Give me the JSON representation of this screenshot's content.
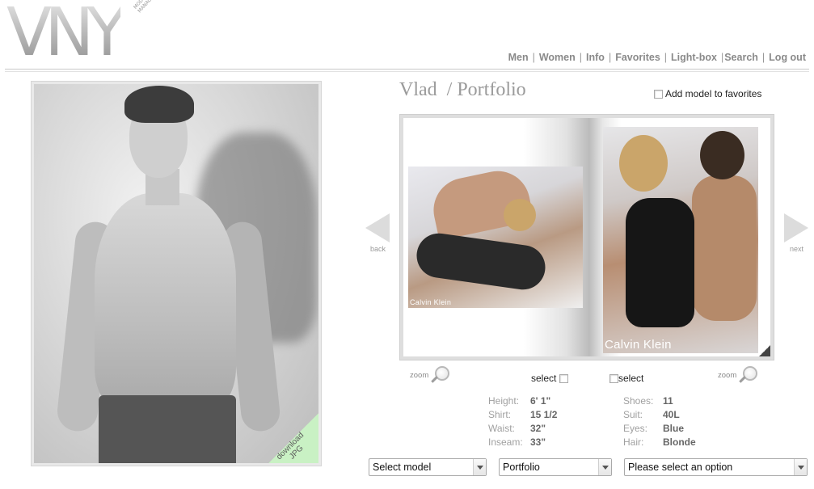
{
  "logo": {
    "text": "VNY",
    "sub_line1": "MODEL",
    "sub_line2": "MANAGEMENT"
  },
  "nav": {
    "items": [
      {
        "label": "Men"
      },
      {
        "label": "Women"
      },
      {
        "label": "Info"
      },
      {
        "label": "Favorites"
      },
      {
        "label": "Light-box"
      },
      {
        "label": "Search"
      },
      {
        "label": "Log out"
      }
    ],
    "separator": "|"
  },
  "main_photo": {
    "download_line1": "download",
    "download_line2": "JPG"
  },
  "title": {
    "name": "Vlad",
    "section": "/ Portfolio"
  },
  "favorites": {
    "label": "Add model to favorites"
  },
  "book": {
    "left_caption": "Calvin Klein",
    "right_caption": "Calvin Klein",
    "back_label": "back",
    "next_label": "next"
  },
  "controls": {
    "zoom_label": "zoom",
    "select_label": "select"
  },
  "stats_left": [
    {
      "label": "Height:",
      "value": "6' 1\""
    },
    {
      "label": "Shirt:",
      "value": "15 1/2"
    },
    {
      "label": "Waist:",
      "value": "32\""
    },
    {
      "label": "Inseam:",
      "value": "33\""
    }
  ],
  "stats_right": [
    {
      "label": "Shoes:",
      "value": "11"
    },
    {
      "label": "Suit:",
      "value": "40L"
    },
    {
      "label": "Eyes:",
      "value": "Blue"
    },
    {
      "label": "Hair:",
      "value": "Blonde"
    }
  ],
  "dropdowns": {
    "model": "Select model",
    "section": "Portfolio",
    "option": "Please select an option"
  }
}
